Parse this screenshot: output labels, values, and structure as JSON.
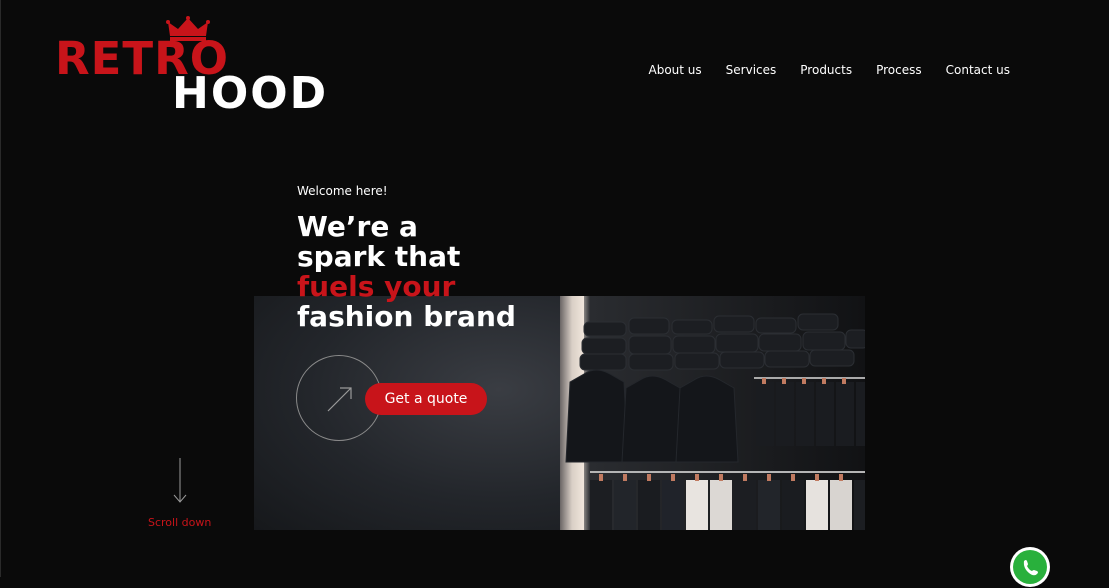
{
  "logo": {
    "line1": "RETRO",
    "line2": "HOOD",
    "icon": "crown-icon"
  },
  "nav": {
    "items": [
      "About us",
      "Services",
      "Products",
      "Process",
      "Contact us"
    ]
  },
  "hero": {
    "welcome": "Welcome here!",
    "headline_line1": "We’re a",
    "headline_line2": "spark that",
    "headline_line3": "fuels your",
    "headline_line4": "fashion brand",
    "cta_label": "Get a quote",
    "cta_icon": "arrow-up-right-icon"
  },
  "scroll": {
    "label": "Scroll down",
    "icon": "arrow-down-icon"
  },
  "floating": {
    "icon": "whatsapp-icon"
  },
  "colors": {
    "background": "#0a0a0a",
    "accent": "#c8141a",
    "text": "#ffffff",
    "whatsapp": "#29b03c"
  }
}
